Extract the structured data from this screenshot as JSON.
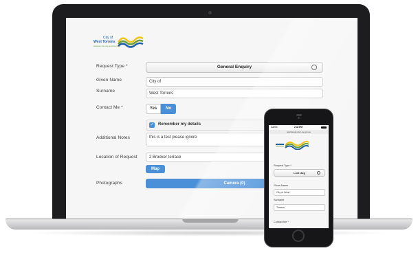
{
  "laptop": {
    "logo": {
      "line1": "City of",
      "line2": "West Torrens",
      "tagline": "between the city and the sea"
    },
    "form": {
      "request_type": {
        "label": "Request Type *",
        "value": "General Enquiry"
      },
      "given_name": {
        "label": "Given Name",
        "value": "City of"
      },
      "surname": {
        "label": "Surname",
        "value": "West Torrens"
      },
      "contact_me": {
        "label": "Contact Me *",
        "yes": "Yes",
        "no": "No",
        "selected": "No"
      },
      "remember": {
        "label": "Remember my details",
        "checked": true
      },
      "additional_notes": {
        "label": "Additional Notes",
        "value": "this is a test please ignore"
      },
      "location": {
        "label": "Location of Request",
        "value": "2 Brooker terrace",
        "map_button": "Map"
      },
      "photographs": {
        "label": "Photographs",
        "camera_button": "Camera (0)"
      }
    }
  },
  "phone": {
    "status": {
      "carrier": "Carrier",
      "time": "2:42 PM"
    },
    "url": "apptheway.wtcc.sa.gov.au",
    "form": {
      "request_type": {
        "label": "Request Type *",
        "value": "Lost dog"
      },
      "given_name": {
        "label": "Given Name",
        "value": "City of West"
      },
      "surname": {
        "label": "Surname",
        "value": "Torrens"
      },
      "contact_me": {
        "label": "Contact Me *"
      }
    }
  },
  "colors": {
    "accent": "#4a90d9",
    "logo_blue": "#1f5ea8",
    "logo_green": "#6a9f3a",
    "device_body": "#1d1d1f"
  }
}
